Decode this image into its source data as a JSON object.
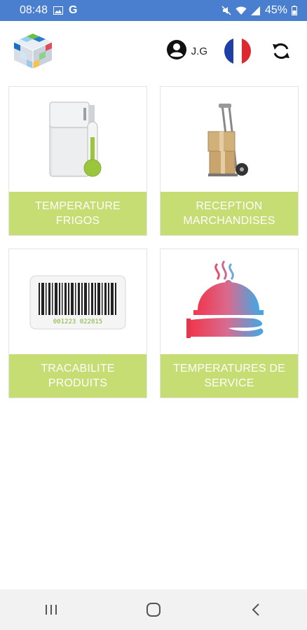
{
  "status_bar": {
    "time": "08:48",
    "battery": "45%",
    "icons": [
      "image-icon",
      "g-icon",
      "mute-icon",
      "wifi-icon",
      "signal-icon",
      "battery-icon"
    ],
    "color": "#4a7fd0"
  },
  "header": {
    "logo": "cube-logo",
    "user": {
      "name": "J.G",
      "icon": "user-circle-icon"
    },
    "language_flag": "france-flag",
    "sync_icon": "sync-icon"
  },
  "tiles": [
    {
      "line1": "TEMPERATURE",
      "line2": "FRIGOS",
      "icon": "fridge-thermometer"
    },
    {
      "line1": "RECEPTION",
      "line2": "MARCHANDISES",
      "icon": "hand-truck-boxes"
    },
    {
      "line1": "TRACABILITE",
      "line2": "PRODUITS",
      "icon": "barcode",
      "barcode_digits": "001223 022815"
    },
    {
      "line1": "TEMPERATURES DE",
      "line2": "SERVICE",
      "icon": "cloche-hand"
    }
  ],
  "theme": {
    "tile_label_bg": "#c5dd72",
    "tile_label_text": "#ffffff"
  },
  "nav": {
    "icons": [
      "recent-apps-icon",
      "home-icon",
      "back-icon"
    ]
  }
}
